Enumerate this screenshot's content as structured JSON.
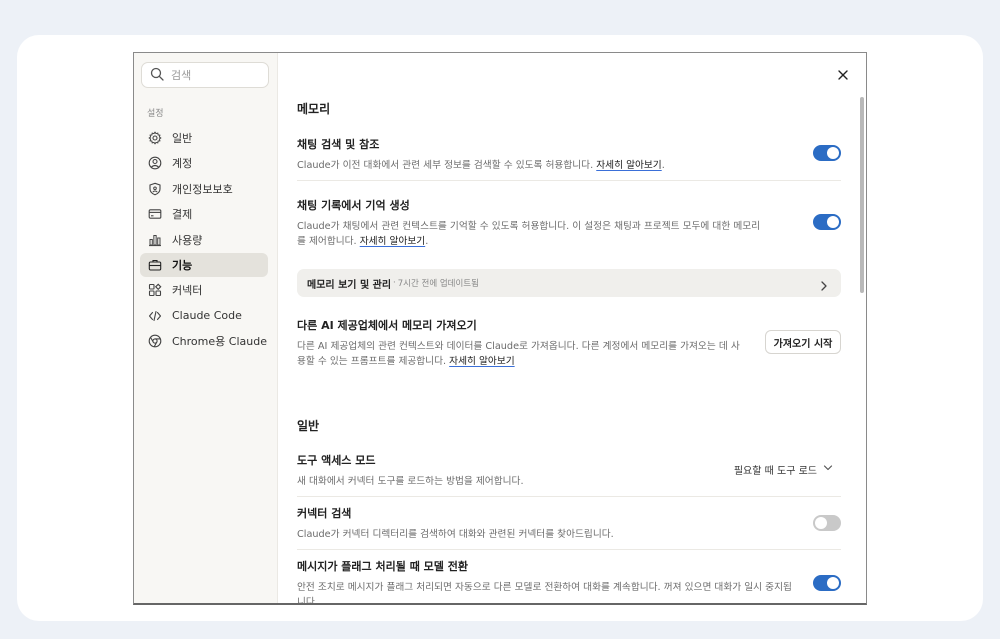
{
  "sidebar": {
    "search_placeholder": "검색",
    "section_label": "설정",
    "items": [
      {
        "label": "일반",
        "icon": "gear-icon"
      },
      {
        "label": "계정",
        "icon": "user-circle-icon"
      },
      {
        "label": "개인정보보호",
        "icon": "shield-icon"
      },
      {
        "label": "결제",
        "icon": "credit-card-icon"
      },
      {
        "label": "사용량",
        "icon": "bar-chart-icon"
      },
      {
        "label": "기능",
        "icon": "briefcase-icon",
        "active": true
      },
      {
        "label": "커넥터",
        "icon": "puzzle-icon"
      },
      {
        "label": "Claude Code",
        "icon": "code-icon"
      },
      {
        "label": "Chrome용 Claude",
        "icon": "chrome-icon"
      }
    ]
  },
  "memory": {
    "section_title": "메모리",
    "chat_search": {
      "title": "채팅 검색 및 참조",
      "desc": "Claude가 이전 대화에서 관련 세부 정보를 검색할 수 있도록 허용합니다. ",
      "link": "자세히 알아보기",
      "enabled": true
    },
    "chat_memory": {
      "title": "채팅 기록에서 기억 생성",
      "desc": "Claude가 채팅에서 관련 컨텍스트를 기억할 수 있도록 허용합니다. 이 설정은 채팅과 프로젝트 모두에 대한 메모리를 제어합니다. ",
      "link": "자세히 알아보기",
      "enabled": true
    },
    "manage_bar": {
      "title": "메모리 보기 및 관리",
      "separator": "·",
      "subtitle": "7시간 전에 업데이트됨"
    },
    "import": {
      "title": "다른 AI 제공업체에서 메모리 가져오기",
      "desc": "다른 AI 제공업체의 관련 컨텍스트와 데이터를 Claude로 가져옵니다. 다른 계정에서 메모리를 가져오는 데 사용할 수 있는 프롬프트를 제공합니다. ",
      "link": "자세히 알아보기",
      "button": "가져오기 시작"
    }
  },
  "general": {
    "section_title": "일반",
    "tool_access": {
      "title": "도구 액세스 모드",
      "desc": "새 대화에서 커넥터 도구를 로드하는 방법을 제어합니다.",
      "selected": "필요할 때 도구 로드"
    },
    "connector_search": {
      "title": "커넥터 검색",
      "desc": "Claude가 커넥터 디렉터리를 검색하여 대화와 관련된 커넥터를 찾아드립니다.",
      "enabled": false
    },
    "model_switch": {
      "title": "메시지가 플래그 처리될 때 모델 전환",
      "desc": "안전 조치로 메시지가 플래그 처리되면 자동으로 다른 모델로 전환하여 대화를 계속합니다. 꺼져 있으면 대화가 일시 중지됩니다.",
      "enabled": true
    }
  },
  "colors": {
    "toggle_on": "#2b6cc4",
    "toggle_off": "#c9c9c9",
    "sidebar_bg": "#f8f7f4",
    "active_item_bg": "#e4e2dc",
    "page_bg": "#edf1f7"
  }
}
